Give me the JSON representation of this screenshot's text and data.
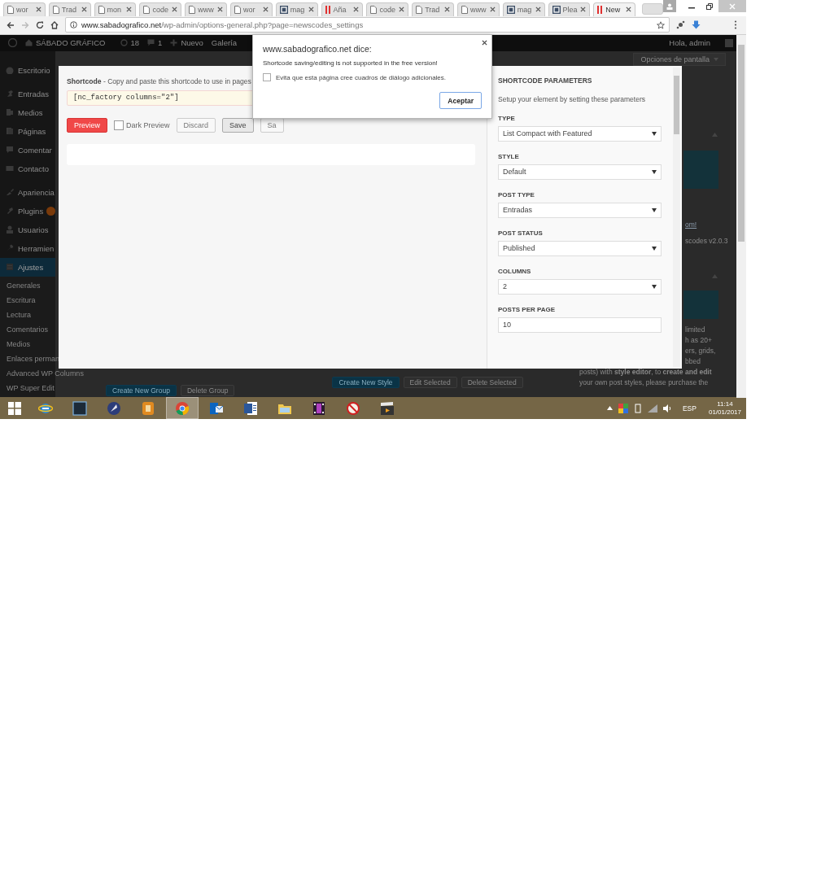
{
  "browser": {
    "tabs": [
      {
        "title": "wor",
        "kind": "page",
        "selected": false
      },
      {
        "title": "Trad",
        "kind": "page",
        "selected": false
      },
      {
        "title": "mon",
        "kind": "page",
        "selected": false
      },
      {
        "title": "code",
        "kind": "page",
        "selected": false
      },
      {
        "title": "www",
        "kind": "page",
        "selected": false
      },
      {
        "title": "wor",
        "kind": "page",
        "selected": false
      },
      {
        "title": "mag",
        "kind": "m",
        "selected": false
      },
      {
        "title": "Aña",
        "kind": "bars",
        "selected": false
      },
      {
        "title": "code",
        "kind": "page",
        "selected": false
      },
      {
        "title": "Trad",
        "kind": "page",
        "selected": false
      },
      {
        "title": "www",
        "kind": "page",
        "selected": false
      },
      {
        "title": "mag",
        "kind": "m",
        "selected": false
      },
      {
        "title": "Plea",
        "kind": "m",
        "selected": false
      },
      {
        "title": "New",
        "kind": "bars",
        "selected": true
      }
    ],
    "address": {
      "domain": "www.sabadografico.net",
      "path": "/wp-admin/options-general.php?page=newscodes_settings"
    }
  },
  "admin_bar": {
    "site": "SÁBADO GRÁFICO",
    "updates": "18",
    "comments": "1",
    "new": "Nuevo",
    "extra": "Galería",
    "greeting": "Hola, admin"
  },
  "screen_options": "Opciones de pantalla",
  "sidebar": {
    "sections": [
      {
        "items": [
          {
            "label": "Escritorio",
            "kind": "gauge",
            "selected": false,
            "badge": false
          }
        ]
      },
      {
        "items": [
          {
            "label": "Entradas",
            "kind": "pin",
            "selected": false,
            "badge": false
          },
          {
            "label": "Medios",
            "kind": "media",
            "selected": false,
            "badge": false
          },
          {
            "label": "Páginas",
            "kind": "pages",
            "selected": false,
            "badge": false
          },
          {
            "label": "Comentar",
            "kind": "comment",
            "selected": false,
            "badge": false
          },
          {
            "label": "Contacto",
            "kind": "mail",
            "selected": false,
            "badge": false
          }
        ]
      },
      {
        "items": [
          {
            "label": "Apariencia",
            "kind": "brush",
            "selected": false,
            "badge": false
          },
          {
            "label": "Plugins",
            "kind": "plug",
            "selected": false,
            "badge": true
          },
          {
            "label": "Usuarios",
            "kind": "user",
            "selected": false,
            "badge": false
          },
          {
            "label": "Herramien",
            "kind": "wrench",
            "selected": false,
            "badge": false
          },
          {
            "label": "Ajustes",
            "kind": "settings",
            "selected": true,
            "badge": false
          }
        ]
      }
    ],
    "submenu": [
      "Generales",
      "Escritura",
      "Lectura",
      "Comentarios",
      "Medios",
      "Enlaces perman",
      "Advanced WP Columns",
      "WP Super Edit"
    ]
  },
  "right_column": {
    "link": "om!",
    "version": "scodes v2.0.3",
    "promo": [
      "limited",
      "h as 20+",
      "ers, grids,",
      "bbed"
    ],
    "promo_lines": [
      "posts) with **style editor**, to **create and edit**",
      "your own post styles, please purchase the"
    ]
  },
  "group_buttons": [
    {
      "label": "Create New Group",
      "kind": "primary"
    },
    {
      "label": "Delete Group",
      "kind": "secondary"
    }
  ],
  "style_buttons": [
    {
      "label": "Create New Style",
      "kind": "primary"
    },
    {
      "label": "Edit Selected",
      "kind": "secondary"
    },
    {
      "label": "Delete Selected",
      "kind": "secondary"
    }
  ],
  "modal": {
    "shortcode_label": "Shortcode",
    "shortcode_hint": " - Copy and paste this shortcode to use in pages",
    "shortcode": "[nc_factory columns=\"2\"]",
    "actions": [
      {
        "label": "Preview",
        "kind": "primary"
      },
      {
        "label": "Dark Preview",
        "kind": "checkbox",
        "checked": false
      },
      {
        "label": "Discard",
        "kind": "button"
      },
      {
        "label": "Save",
        "kind": "button"
      },
      {
        "label": "Sa",
        "kind": "button"
      }
    ],
    "params": {
      "title": "SHORTCODE PARAMETERS",
      "subtitle": "Setup your element by setting these parameters",
      "fields": [
        {
          "label": "TYPE",
          "value": "List Compact with Featured",
          "kind": "select"
        },
        {
          "label": "STYLE",
          "value": "Default",
          "kind": "select"
        },
        {
          "label": "POST TYPE",
          "value": "Entradas",
          "kind": "select"
        },
        {
          "label": "POST STATUS",
          "value": "Published",
          "kind": "select"
        },
        {
          "label": "COLUMNS",
          "value": "2",
          "kind": "select"
        },
        {
          "label": "POSTS PER PAGE",
          "value": "10",
          "kind": "input"
        }
      ]
    }
  },
  "alert": {
    "title": "www.sabadografico.net dice:",
    "message": "Shortcode saving/editing is not supported in the free version!",
    "checkbox": {
      "label": "Evita que esta página cree cuadros de diálogo adicionales.",
      "checked": false
    },
    "button": "Aceptar"
  },
  "taskbar": {
    "apps": [
      {
        "kind": "ie",
        "selected": false
      },
      {
        "kind": "lr",
        "selected": false
      },
      {
        "kind": "feather",
        "selected": false
      },
      {
        "kind": "archive",
        "selected": false
      },
      {
        "kind": "chrome",
        "selected": true
      },
      {
        "kind": "outlook",
        "selected": false
      },
      {
        "kind": "word",
        "selected": false
      },
      {
        "kind": "folder",
        "selected": false
      },
      {
        "kind": "film",
        "selected": false
      },
      {
        "kind": "nosign",
        "selected": false
      },
      {
        "kind": "clapper",
        "selected": false
      }
    ],
    "language": "ESP",
    "time": "11:14",
    "date": "01/01/2017"
  }
}
